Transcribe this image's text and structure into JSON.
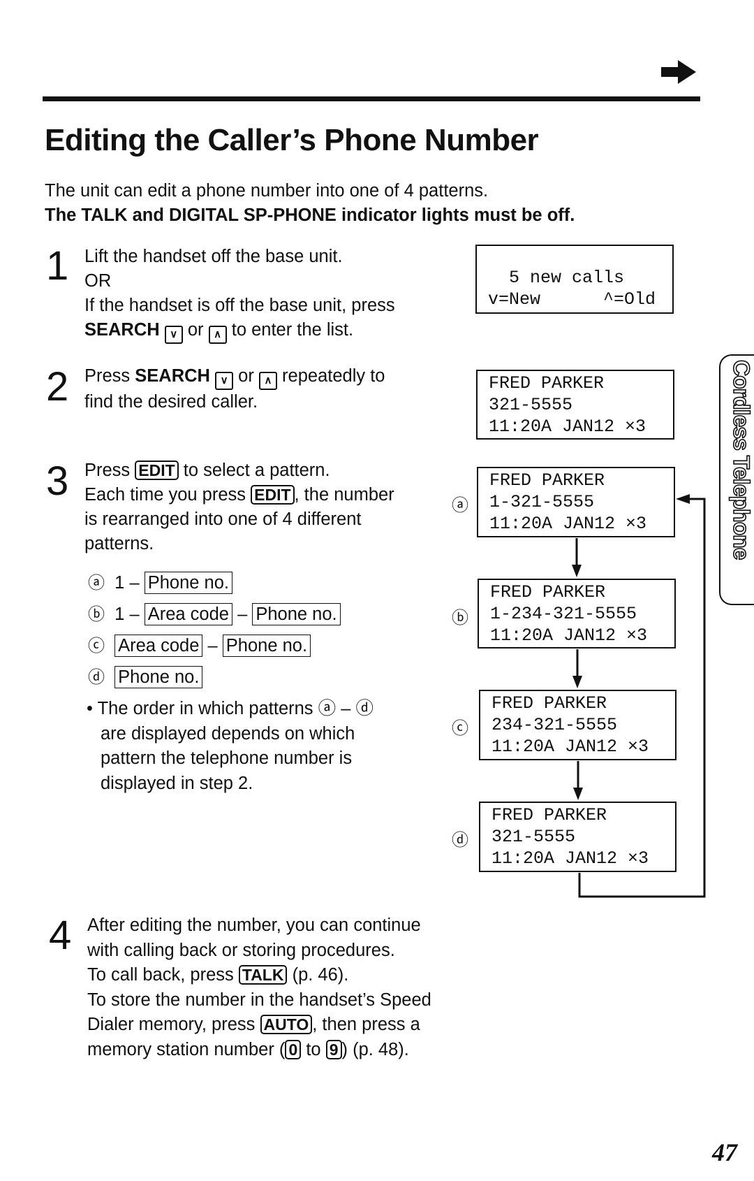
{
  "header": {
    "next_arrow_icon": "right-arrow-icon"
  },
  "title": "Editing the Caller’s Phone Number",
  "intro": {
    "line1": "The unit can edit a phone number into one of 4 patterns.",
    "line2": "The TALK and DIGITAL SP-PHONE indicator lights must be off."
  },
  "step1": {
    "number": "1",
    "line1": "Lift the handset off the base unit.",
    "line2": "OR",
    "line3": "If the handset is off the base unit, press",
    "search": "SEARCH",
    "or": "or",
    "end": "to enter the list."
  },
  "step2": {
    "number": "2",
    "press": "Press",
    "search": "SEARCH",
    "or": "or",
    "rest": "repeatedly to",
    "line2": "find the desired caller."
  },
  "step3": {
    "number": "3",
    "press": "Press",
    "edit": "EDIT",
    "rest1": "to select a pattern.",
    "line2a": "Each time you press",
    "line2b": ", the number",
    "line3": "is rearranged into one of 4 different",
    "line4": "patterns.",
    "patterns": {
      "a": "ⓐ",
      "b": "ⓑ",
      "c": "ⓒ",
      "d": "ⓓ",
      "one": "1",
      "dash": "–",
      "phone": "Phone no.",
      "area": "Area code"
    },
    "bullet": "•",
    "note1": "The order in which patterns ⓐ – ⓓ",
    "note2": "are displayed depends on which",
    "note3": "pattern the telephone number is",
    "note4": "displayed in step 2."
  },
  "step4": {
    "number": "4",
    "line1": "After editing the number, you can continue",
    "line2": "with calling back or storing procedures.",
    "line3a": "To call back, press",
    "talk": "TALK",
    "line3b": "(p. 46).",
    "line4": "To store the number in the handset’s Speed",
    "line5a": "Dialer memory, press",
    "auto": "AUTO",
    "line5b": ", then press a",
    "line6a": "memory station number (",
    "k0": "0",
    "to": "to",
    "k9": "9",
    "line6b": ") (p. 48)."
  },
  "displays": {
    "initial": {
      "line1": "  5 new calls",
      "line2": "v=New      ^=Old"
    },
    "step2": {
      "line1": "FRED PARKER",
      "line2": "321-5555",
      "line3": "11:20A JAN12 ×3"
    },
    "a": {
      "label": "ⓐ",
      "line1": "FRED PARKER",
      "line2": "1-321-5555",
      "line3": "11:20A JAN12 ×3"
    },
    "b": {
      "label": "ⓑ",
      "line1": "FRED PARKER",
      "line2": "1-234-321-5555",
      "line3": "11:20A JAN12 ×3"
    },
    "c": {
      "label": "ⓒ",
      "line1": "FRED PARKER",
      "line2": "234-321-5555",
      "line3": "11:20A JAN12 ×3"
    },
    "d": {
      "label": "ⓓ",
      "line1": "FRED PARKER",
      "line2": "321-5555",
      "line3": "11:20A JAN12 ×3"
    }
  },
  "side_tab": "Cordless Telephone",
  "page_number": "47"
}
